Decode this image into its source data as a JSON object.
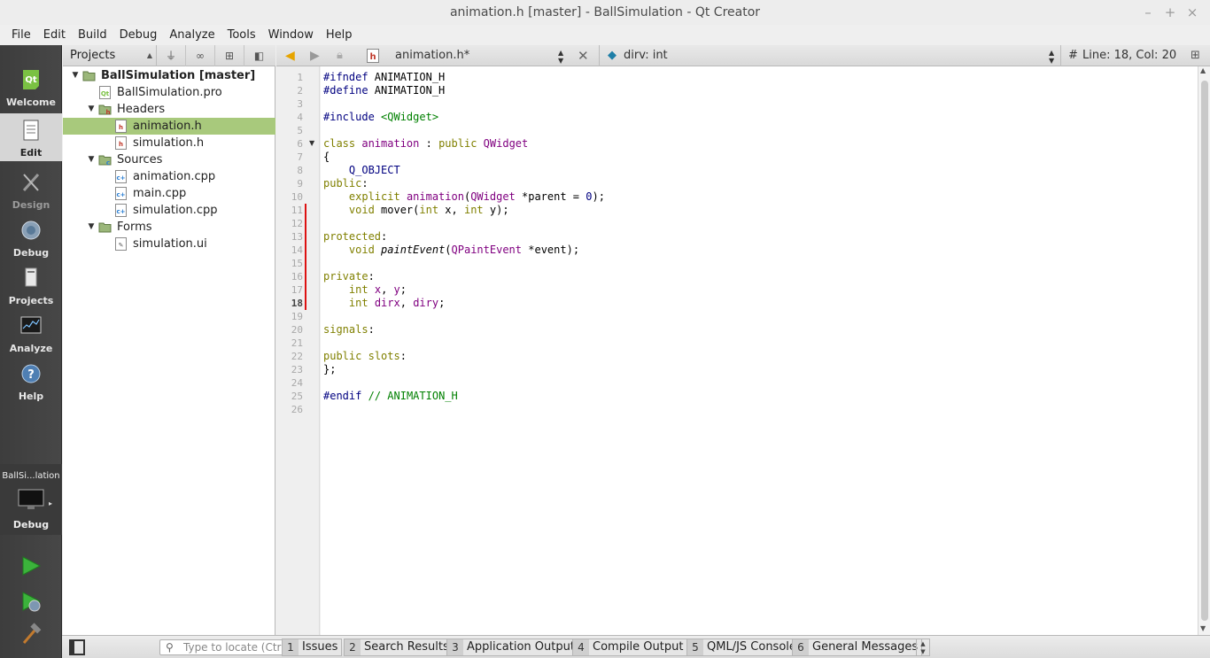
{
  "window": {
    "title": "animation.h [master] - BallSimulation - Qt Creator",
    "controls": [
      "–",
      "+",
      "×"
    ]
  },
  "menu": [
    "File",
    "Edit",
    "Build",
    "Debug",
    "Analyze",
    "Tools",
    "Window",
    "Help"
  ],
  "modes": [
    {
      "label": "Welcome",
      "icon": "qt-logo-icon"
    },
    {
      "label": "Edit",
      "icon": "document-icon"
    },
    {
      "label": "Design",
      "icon": "design-pen-icon"
    },
    {
      "label": "Debug",
      "icon": "bug-icon"
    },
    {
      "label": "Projects",
      "icon": "projects-icon"
    },
    {
      "label": "Analyze",
      "icon": "analyze-screen-icon"
    },
    {
      "label": "Help",
      "icon": "help-icon"
    }
  ],
  "active_mode": "Edit",
  "target": {
    "name": "BallSi...lation",
    "build": "Debug"
  },
  "navigator": {
    "combo": "Projects"
  },
  "editor_toolbar": {
    "file_combo": "animation.h*",
    "symbol_combo": "dirv: int",
    "hash": "#",
    "position": "Line: 18, Col: 20"
  },
  "tree": [
    {
      "level": 0,
      "text": "BallSimulation [master]",
      "icon": "project",
      "expand": "open",
      "bold": true
    },
    {
      "level": 1,
      "text": "BallSimulation.pro",
      "icon": "pro-file",
      "expand": "none"
    },
    {
      "level": 1,
      "text": "Headers",
      "icon": "folder-h",
      "expand": "open"
    },
    {
      "level": 2,
      "text": "animation.h",
      "icon": "h-file",
      "expand": "none",
      "selected": true
    },
    {
      "level": 2,
      "text": "simulation.h",
      "icon": "h-file",
      "expand": "none"
    },
    {
      "level": 1,
      "text": "Sources",
      "icon": "folder-cpp",
      "expand": "open"
    },
    {
      "level": 2,
      "text": "animation.cpp",
      "icon": "cpp-file",
      "expand": "none"
    },
    {
      "level": 2,
      "text": "main.cpp",
      "icon": "cpp-file",
      "expand": "none"
    },
    {
      "level": 2,
      "text": "simulation.cpp",
      "icon": "cpp-file",
      "expand": "none"
    },
    {
      "level": 1,
      "text": "Forms",
      "icon": "folder-ui",
      "expand": "open"
    },
    {
      "level": 2,
      "text": "simulation.ui",
      "icon": "ui-file",
      "expand": "none"
    }
  ],
  "code": {
    "current_line": 18,
    "fold_line": 6,
    "modified_lines": [
      11,
      12,
      13,
      14,
      15,
      16,
      17,
      18
    ],
    "lines": [
      [
        [
          "p",
          "#ifndef"
        ],
        [
          "",
          " ANIMATION_H"
        ]
      ],
      [
        [
          "p",
          "#define"
        ],
        [
          "",
          " ANIMATION_H"
        ]
      ],
      [],
      [
        [
          "p",
          "#include"
        ],
        [
          "",
          " "
        ],
        [
          "s",
          "<QWidget>"
        ]
      ],
      [],
      [
        [
          "k",
          "class"
        ],
        [
          "",
          " "
        ],
        [
          "t",
          "animation"
        ],
        [
          "",
          " : "
        ],
        [
          "k",
          "public"
        ],
        [
          "",
          " "
        ],
        [
          "t",
          "QWidget"
        ]
      ],
      [
        [
          "",
          "{"
        ]
      ],
      [
        [
          "",
          "    "
        ],
        [
          "n",
          "Q_OBJECT"
        ]
      ],
      [
        [
          "k",
          "public"
        ],
        [
          "",
          ":"
        ]
      ],
      [
        [
          "",
          "    "
        ],
        [
          "k",
          "explicit"
        ],
        [
          "",
          " "
        ],
        [
          "t",
          "animation"
        ],
        [
          "",
          "("
        ],
        [
          "t",
          "QWidget"
        ],
        [
          "",
          " *parent = "
        ],
        [
          "n",
          "0"
        ],
        [
          "",
          ");"
        ]
      ],
      [
        [
          "",
          "    "
        ],
        [
          "k",
          "void"
        ],
        [
          "",
          " mover("
        ],
        [
          "k",
          "int"
        ],
        [
          "",
          " x, "
        ],
        [
          "k",
          "int"
        ],
        [
          "",
          " y);"
        ]
      ],
      [],
      [
        [
          "k",
          "protected"
        ],
        [
          "",
          ":"
        ]
      ],
      [
        [
          "",
          "    "
        ],
        [
          "k",
          "void"
        ],
        [
          "",
          " "
        ],
        [
          "it2",
          "paintEvent"
        ],
        [
          "",
          "("
        ],
        [
          "t",
          "QPaintEvent"
        ],
        [
          "",
          " *event);"
        ]
      ],
      [],
      [
        [
          "k",
          "private"
        ],
        [
          "",
          ":"
        ]
      ],
      [
        [
          "",
          "    "
        ],
        [
          "k",
          "int"
        ],
        [
          "",
          " "
        ],
        [
          "t",
          "x"
        ],
        [
          "",
          ", "
        ],
        [
          "t",
          "y"
        ],
        [
          "",
          ";"
        ]
      ],
      [
        [
          "",
          "    "
        ],
        [
          "k",
          "int"
        ],
        [
          "",
          " "
        ],
        [
          "t",
          "dirx"
        ],
        [
          "",
          ", "
        ],
        [
          "t",
          "diry"
        ],
        [
          "",
          ";"
        ]
      ],
      [],
      [
        [
          "k",
          "signals"
        ],
        [
          "",
          ":"
        ]
      ],
      [],
      [
        [
          "k",
          "public"
        ],
        [
          "",
          " "
        ],
        [
          "k",
          "slots"
        ],
        [
          "",
          ":"
        ]
      ],
      [
        [
          "",
          "};"
        ]
      ],
      [],
      [
        [
          "p",
          "#endif"
        ],
        [
          "",
          " "
        ],
        [
          "s",
          "// ANIMATION_H"
        ]
      ],
      []
    ]
  },
  "statusbar": {
    "locator_placeholder": "Type to locate (Ctrl+K)",
    "panes": [
      {
        "num": "1",
        "label": "Issues"
      },
      {
        "num": "2",
        "label": "Search Results"
      },
      {
        "num": "3",
        "label": "Application Output"
      },
      {
        "num": "4",
        "label": "Compile Output"
      },
      {
        "num": "5",
        "label": "QML/JS Console"
      },
      {
        "num": "6",
        "label": "General Messages"
      }
    ]
  },
  "colors": {
    "accent_selection": "#a8c97c",
    "modebar_bg": "#444444",
    "keyword": "#808000",
    "preprocessor": "#000080",
    "type": "#800080",
    "string": "#008000",
    "change_marker": "#dd1111"
  }
}
